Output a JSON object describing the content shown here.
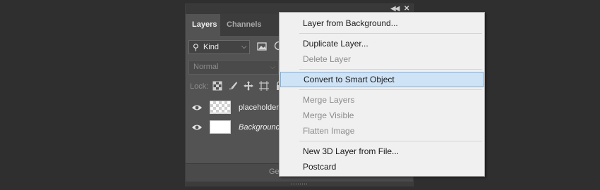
{
  "panel": {
    "tabs": [
      "Layers",
      "Channels"
    ],
    "active_tab": "Layers",
    "filter": {
      "label": "Kind"
    },
    "blend_mode": "Normal",
    "lock_label": "Lock:",
    "layers": [
      {
        "name": "placeholder",
        "thumbnail": "transparent",
        "visible": true,
        "italic": false
      },
      {
        "name": "Background",
        "thumbnail": "white",
        "visible": true,
        "italic": true
      }
    ],
    "footer_text": "Ge"
  },
  "menu": {
    "items": [
      {
        "label": "Layer from Background...",
        "enabled": true
      },
      {
        "label": "Duplicate Layer...",
        "enabled": true
      },
      {
        "label": "Delete Layer",
        "enabled": false
      },
      {
        "label": "Convert to Smart Object",
        "enabled": true,
        "highlighted": true
      },
      {
        "label": "Merge Layers",
        "enabled": false
      },
      {
        "label": "Merge Visible",
        "enabled": false
      },
      {
        "label": "Flatten Image",
        "enabled": false
      },
      {
        "label": "New 3D Layer from File...",
        "enabled": true
      },
      {
        "label": "Postcard",
        "enabled": true
      }
    ]
  },
  "colors": {
    "background": "#2f2f2f",
    "panel": "#535353",
    "menu": "#f0f0f0",
    "menu_highlight": "#cfe3f6",
    "menu_highlight_border": "#7aaede",
    "disabled_text": "#8c8c8c"
  }
}
